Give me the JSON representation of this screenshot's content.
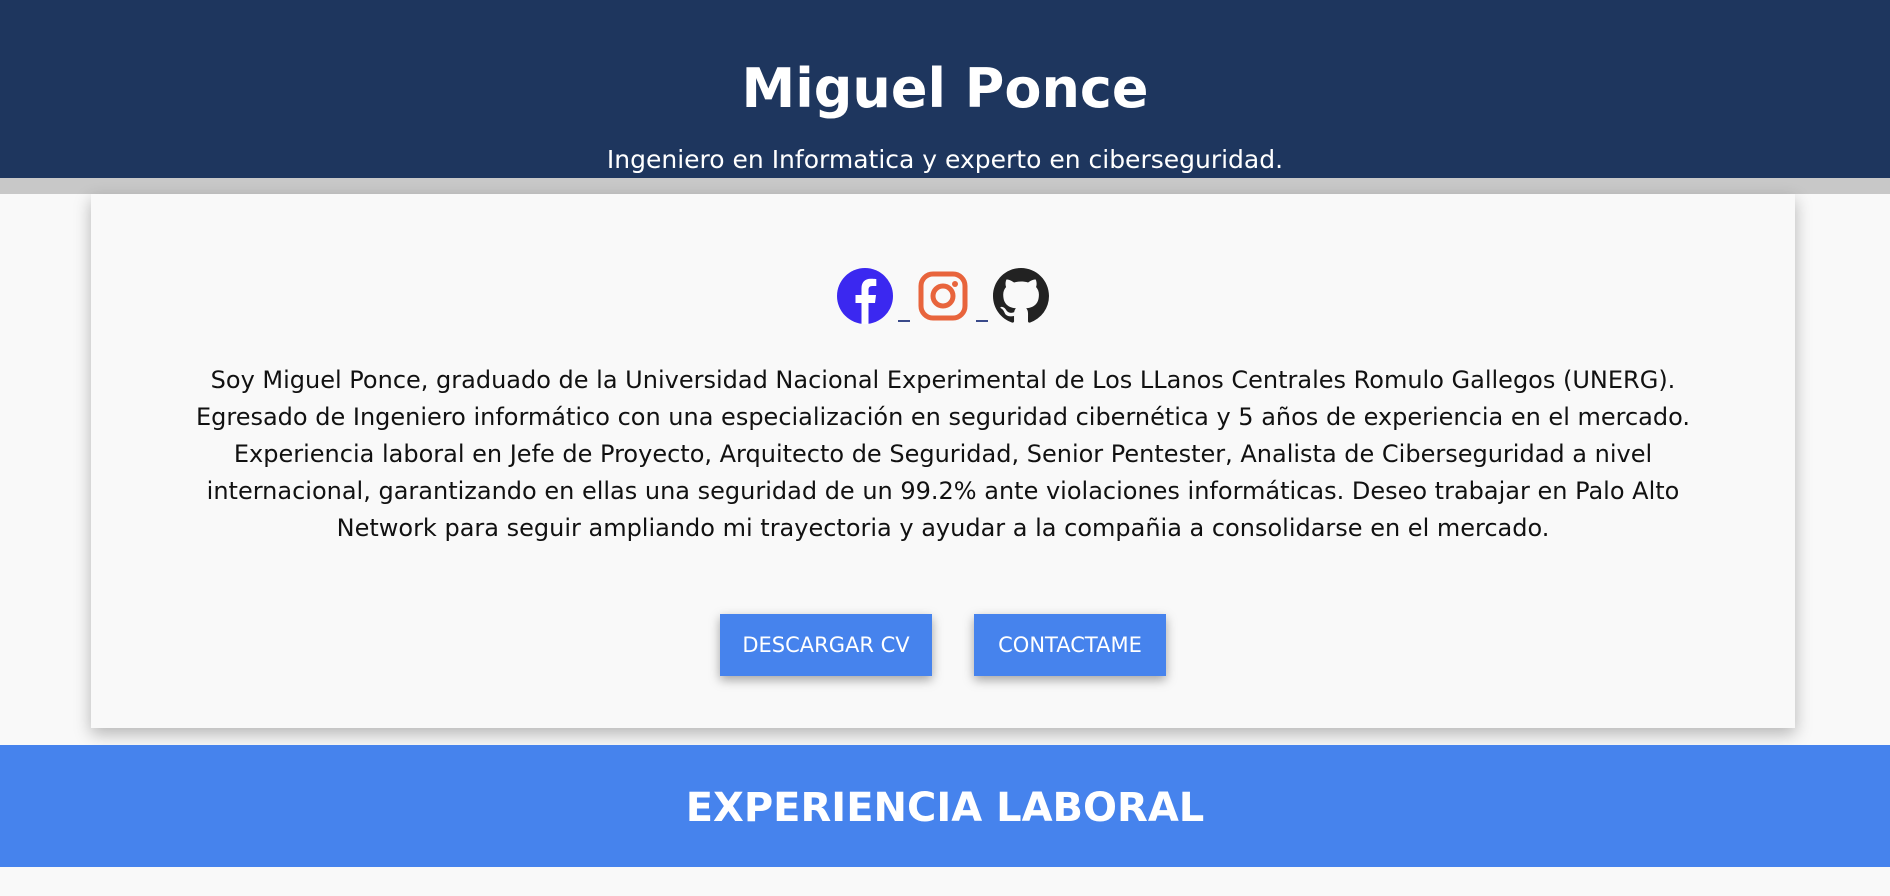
{
  "header": {
    "title": "Miguel Ponce",
    "subtitle": "Ingeniero en Informatica y experto en ciberseguridad."
  },
  "social": [
    {
      "name": "facebook-icon",
      "color": "#3b28f0"
    },
    {
      "name": "instagram-icon",
      "color": "#e8643c"
    },
    {
      "name": "github-icon",
      "color": "#222222"
    }
  ],
  "bio": "Soy Miguel Ponce, graduado de la Universidad Nacional Experimental de Los LLanos Centrales Romulo Gallegos (UNERG). Egresado de Ingeniero informático con una especialización en seguridad cibernética y 5 años de experiencia en el mercado. Experiencia laboral en Jefe de Proyecto, Arquitecto de Seguridad, Senior Pentester, Analista de Ciberseguridad a nivel internacional, garantizando en ellas una seguridad de un 99.2% ante violaciones informáticas. Deseo trabajar en Palo Alto Network para seguir ampliando mi trayectoria y ayudar a la compañia a consolidarse en el mercado.",
  "buttons": {
    "download_cv": "DESCARGAR CV",
    "contact": "CONTACTAME"
  },
  "section": {
    "title": "EXPERIENCIA LABORAL"
  },
  "colors": {
    "header_bg": "#1e365e",
    "accent": "#4683ed",
    "page_bg": "#f9f9f9"
  }
}
